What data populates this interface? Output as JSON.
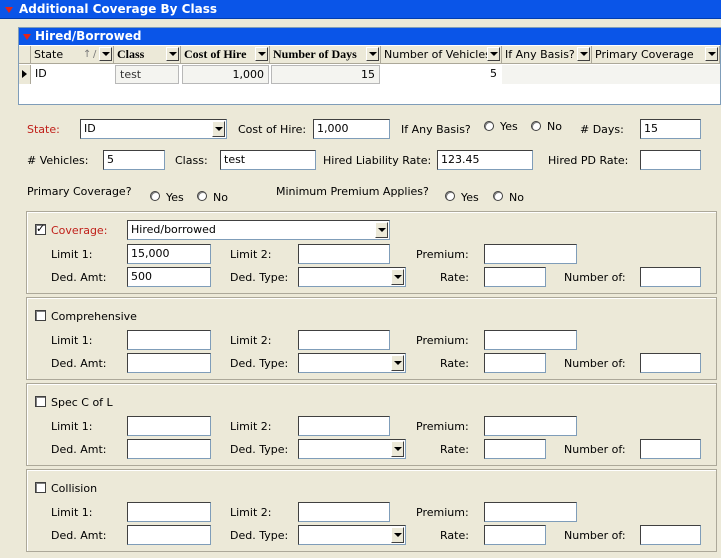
{
  "title": "Additional Coverage By Class",
  "grid": {
    "title": "Hired/Borrowed",
    "columns": [
      "State",
      "Class",
      "Cost of Hire",
      "Number of Days",
      "Number of Vehicles",
      "If Any Basis?",
      "Primary  Coverage"
    ],
    "row": {
      "state": "ID",
      "class": "test",
      "cost_of_hire": "1,000",
      "number_of_days": "15",
      "number_of_vehicles": "5"
    }
  },
  "form": {
    "state_label": "State:",
    "state_value": "ID",
    "cost_of_hire_label": "Cost of Hire:",
    "cost_of_hire_value": "1,000",
    "if_any_basis_label": "If Any Basis?",
    "yes": "Yes",
    "no": "No",
    "days_label": "# Days:",
    "days_value": "15",
    "vehicles_label": "# Vehicles:",
    "vehicles_value": "5",
    "class_label": "Class:",
    "class_value": "test",
    "hired_liability_rate_label": "Hired Liability Rate:",
    "hired_liability_rate_value": "123.45",
    "hired_pd_rate_label": "Hired PD Rate:",
    "hired_pd_rate_value": "",
    "primary_coverage_label": "Primary Coverage?",
    "minimum_premium_label": "Minimum Premium Applies?"
  },
  "labels": {
    "limit1": "Limit 1:",
    "limit2": "Limit 2:",
    "premium": "Premium:",
    "ded_amt": "Ded. Amt:",
    "ded_type": "Ded. Type:",
    "rate": "Rate:",
    "number_of": "Number of:"
  },
  "coverages": [
    {
      "label": "Coverage:",
      "checked": true,
      "select_value": "Hired/borrowed",
      "limit1": "15,000",
      "ded_amt": "500"
    },
    {
      "label": "Comprehensive",
      "checked": false,
      "limit1": "",
      "ded_amt": ""
    },
    {
      "label": "Spec C of L",
      "checked": false,
      "limit1": "",
      "ded_amt": ""
    },
    {
      "label": "Collision",
      "checked": false,
      "limit1": "",
      "ded_amt": ""
    }
  ]
}
